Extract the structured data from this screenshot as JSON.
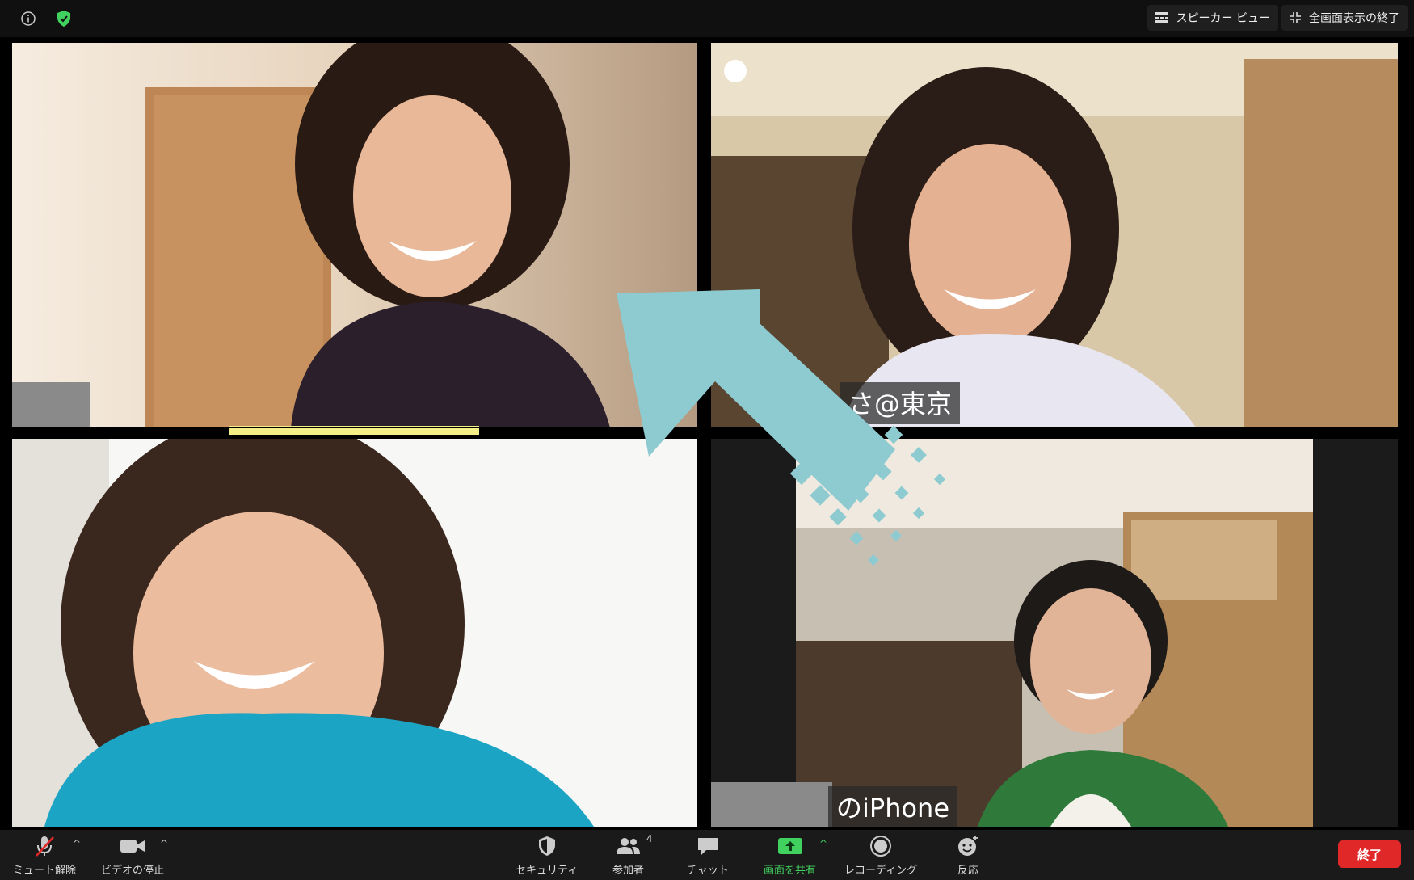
{
  "topbar": {
    "info_icon": "info-icon",
    "security_icon": "shield-check-icon",
    "speaker_view_label": "スピーカー ビュー",
    "exit_fullscreen_label": "全画面表示の終了"
  },
  "participants": [
    {
      "name": "",
      "active_speaker": true
    },
    {
      "name": "さ@東京"
    },
    {
      "name": ""
    },
    {
      "name": "のiPhone"
    }
  ],
  "toolbar": {
    "mute_label": "ミュート解除",
    "video_label": "ビデオの停止",
    "security_label": "セキュリティ",
    "participants_label": "参加者",
    "participants_count": "4",
    "chat_label": "チャット",
    "share_label": "画面を共有",
    "record_label": "レコーディング",
    "reactions_label": "反応",
    "end_label": "終了"
  },
  "colors": {
    "accent_green": "#41d15f",
    "end_red": "#e02828",
    "arrow": "#8ecbd1",
    "speaker_highlight": "#f4ef87"
  }
}
